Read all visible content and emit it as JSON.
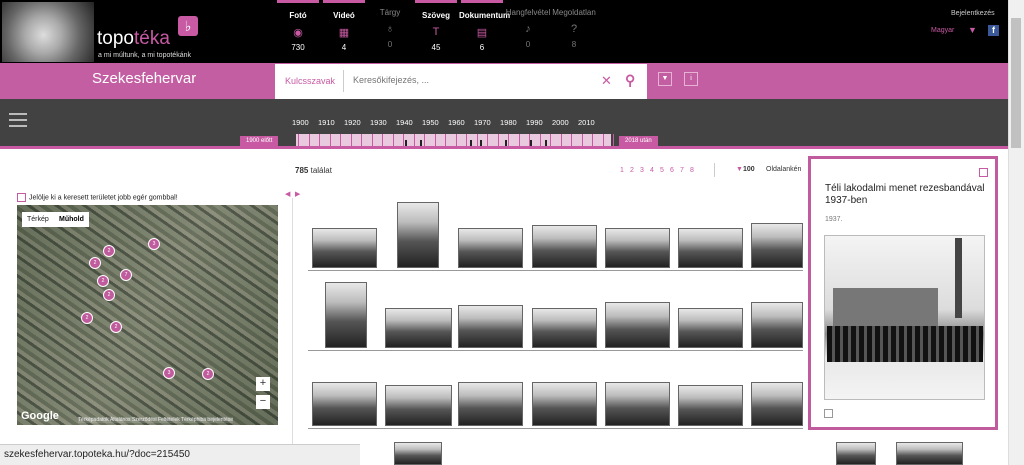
{
  "header": {
    "logo_text_a": "topo",
    "logo_text_b": "téka",
    "tagline": "a mi múltunk, a mi topotékánk",
    "login": "Bejelentkezés",
    "language": "Magyar",
    "categories": [
      {
        "label": "Fotó",
        "count": "730",
        "icon": "photo-icon",
        "active": true
      },
      {
        "label": "Videó",
        "count": "4",
        "icon": "video-icon",
        "active": true
      },
      {
        "label": "Tárgy",
        "count": "0",
        "icon": "object-icon",
        "active": false
      },
      {
        "label": "Szöveg",
        "count": "45",
        "icon": "text-icon",
        "active": true
      },
      {
        "label": "Dokumentum",
        "count": "6",
        "icon": "document-icon",
        "active": true
      },
      {
        "label": "Hangfelvétel",
        "count": "0",
        "icon": "audio-icon",
        "active": false
      },
      {
        "label": "Megoldatlan",
        "count": "8",
        "icon": "question-icon",
        "active": false
      }
    ]
  },
  "search": {
    "city": "Szekesfehervar",
    "keywords_label": "Kulcsszavak",
    "placeholder": "Keresőkifejezés, ..."
  },
  "timeline": {
    "years": [
      "1900",
      "1910",
      "1920",
      "1930",
      "1940",
      "1950",
      "1960",
      "1970",
      "1980",
      "1990",
      "2000",
      "2010"
    ],
    "before_label": "1900 előtt",
    "after_label": "2018 után"
  },
  "results": {
    "count": "785",
    "count_suffix": "találat",
    "pages": [
      "1",
      "2",
      "3",
      "4",
      "5",
      "6",
      "7",
      "8"
    ],
    "per_page": "100",
    "per_page_label": "Oldalankén"
  },
  "map": {
    "hint": "Jelölje ki a keresett területet jobb egér gombbal!",
    "tab_map": "Térkép",
    "tab_satellite": "Műhold",
    "google": "Google",
    "footer": "Térképadatok   Általános Szerződési Feltételek   Térképhiba bejelentése",
    "pins": [
      "3",
      "2",
      "2",
      "7",
      "2",
      "2",
      "2",
      "2",
      "3",
      "2"
    ]
  },
  "card": {
    "title": "Téli lakodalmi menet rezesbandával 1937-ben",
    "year": "1937."
  },
  "status_url": "szekesfehervar.topoteka.hu/?doc=215450",
  "colors": {
    "accent": "#c85aa3",
    "bar": "#424242"
  }
}
